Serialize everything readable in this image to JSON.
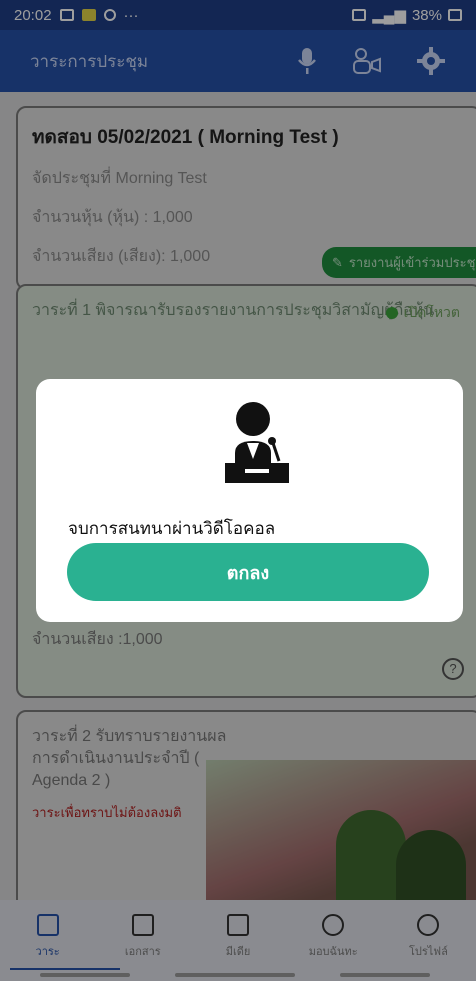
{
  "status": {
    "time": "20:02",
    "battery": "38%"
  },
  "appbar": {
    "title": "วาระการประชุม"
  },
  "meeting": {
    "title": "ทดสอบ 05/02/2021 ( Morning Test )",
    "line1": "จัดประชุมที่ Morning Test",
    "line2": "จำนวนหุ้น (หุ้น) : 1,000",
    "line3": "จำนวนเสียง (เสียง): 1,000",
    "chip": "รายงานผู้เข้าร่วมประชุม"
  },
  "agenda1": {
    "title": "วาระที่ 1 พิจารณารับรองรายงานการประชุมวิสามัญผู้ถือหุ้น",
    "status": "เปิดโหวต",
    "votes": "จำนวนเสียง :1,000"
  },
  "agenda2": {
    "title": "วาระที่ 2 รับทราบรายงานผลการดำเนินงานประจำปี ( Agenda 2 )",
    "note": "วาระเพื่อทราบไม่ต้องลงมติ"
  },
  "dialog": {
    "message": "จบการสนทนาผ่านวิดีโอคอล",
    "ok": "ตกลง"
  },
  "bottom_nav": [
    {
      "label": "วาระ"
    },
    {
      "label": "เอกสาร"
    },
    {
      "label": "มีเดีย"
    },
    {
      "label": "มอบฉันทะ"
    },
    {
      "label": "โปรไฟล์"
    }
  ]
}
